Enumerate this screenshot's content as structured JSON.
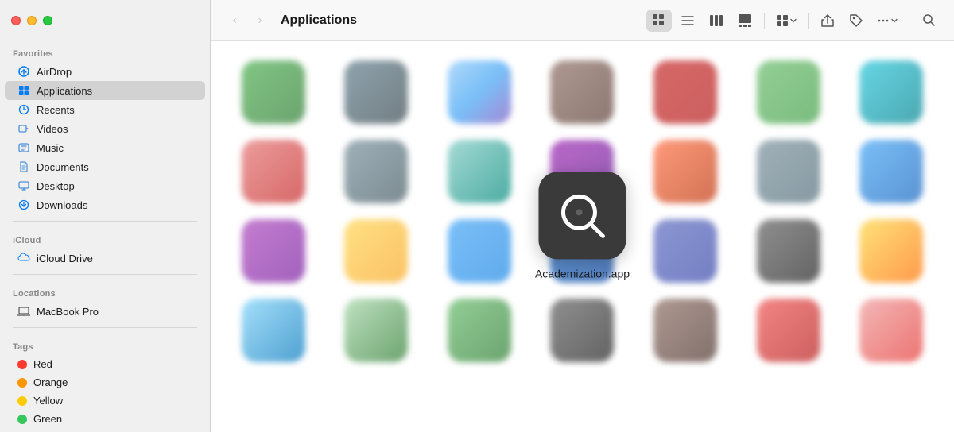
{
  "window": {
    "title": "Applications"
  },
  "titlebar": {
    "close_label": "close",
    "minimize_label": "minimize",
    "maximize_label": "maximize"
  },
  "sidebar": {
    "favorites_header": "Favorites",
    "icloud_header": "iCloud",
    "locations_header": "Locations",
    "tags_header": "Tags",
    "favorites_items": [
      {
        "id": "airdrop",
        "label": "AirDrop",
        "icon": "airdrop-icon"
      },
      {
        "id": "applications",
        "label": "Applications",
        "icon": "applications-icon",
        "active": true
      },
      {
        "id": "recents",
        "label": "Recents",
        "icon": "recents-icon"
      },
      {
        "id": "videos",
        "label": "Videos",
        "icon": "videos-icon"
      },
      {
        "id": "music",
        "label": "Music",
        "icon": "music-icon"
      },
      {
        "id": "documents",
        "label": "Documents",
        "icon": "documents-icon"
      },
      {
        "id": "desktop",
        "label": "Desktop",
        "icon": "desktop-icon"
      },
      {
        "id": "downloads",
        "label": "Downloads",
        "icon": "downloads-icon"
      }
    ],
    "icloud_items": [
      {
        "id": "icloud-drive",
        "label": "iCloud Drive",
        "icon": "icloud-icon"
      }
    ],
    "locations_items": [
      {
        "id": "macbook-pro",
        "label": "MacBook Pro",
        "icon": "laptop-icon"
      }
    ],
    "tags": [
      {
        "id": "red",
        "label": "Red",
        "color": "#ff3b30"
      },
      {
        "id": "orange",
        "label": "Orange",
        "color": "#ff9500"
      },
      {
        "id": "yellow",
        "label": "Yellow",
        "color": "#ffcc00"
      },
      {
        "id": "green",
        "label": "Green",
        "color": "#34c759"
      }
    ]
  },
  "toolbar": {
    "back_label": "‹",
    "forward_label": "›",
    "title": "Applications",
    "view_icons_label": "⊞",
    "view_list_label": "☰",
    "view_columns_label": "⊟",
    "view_gallery_label": "⊡",
    "view_groups_label": "⊞▾",
    "share_label": "↑",
    "tag_label": "⬡",
    "more_label": "···▾",
    "search_label": "🔍"
  },
  "focused_app": {
    "name": "Academization.app",
    "icon_description": "magnifying-glass"
  },
  "colors": {
    "sidebar_bg": "#f0f0f0",
    "main_bg": "#ffffff",
    "border": "#d0d0d0",
    "active_item": "rgba(0,0,0,0.12)",
    "accent_blue": "#007aff"
  }
}
